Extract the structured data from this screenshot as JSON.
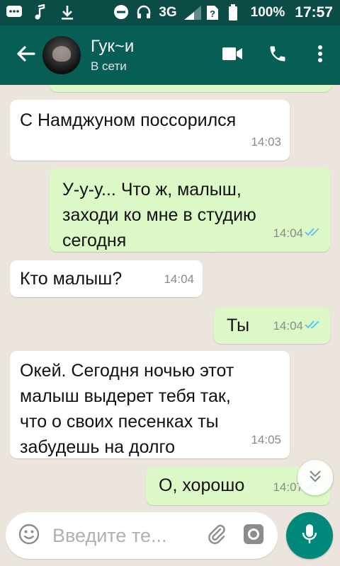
{
  "status_bar": {
    "network": "3G",
    "battery": "100%",
    "time": "17:57"
  },
  "header": {
    "contact_name": "Гук~и",
    "contact_status": "В сети",
    "icons": [
      "back-arrow-icon",
      "video-call-icon",
      "phone-icon",
      "more-vert-icon"
    ]
  },
  "messages": [
    {
      "direction": "in",
      "text": "С Намджуном поссорился",
      "time": "14:03"
    },
    {
      "direction": "out",
      "text": "У-у-у... Что ж, малыш,\nзаходи ко мне в студию\nсегодня",
      "time": "14:04",
      "read": true
    },
    {
      "direction": "in",
      "text": "Кто малыш?",
      "time": "14:04"
    },
    {
      "direction": "out",
      "text": "Ты",
      "time": "14:04",
      "read": true
    },
    {
      "direction": "in",
      "text": "Окей. Сегодня ночью этот\nмалыш выдерет тебя так,\nчто о своих песенках ты\nзабудешь на долго",
      "time": "14:05"
    },
    {
      "direction": "out",
      "text": "О, хорошо",
      "time": "14:07",
      "read": true
    }
  ],
  "input": {
    "placeholder": "Введите те..."
  },
  "colors": {
    "header": "#075e54",
    "status_bar": "#0b4d46",
    "outgoing_bubble": "#dcf8c6",
    "incoming_bubble": "#ffffff",
    "read_ticks": "#4fc3f7",
    "mic_button": "#00897b",
    "background": "#ece5dd"
  }
}
